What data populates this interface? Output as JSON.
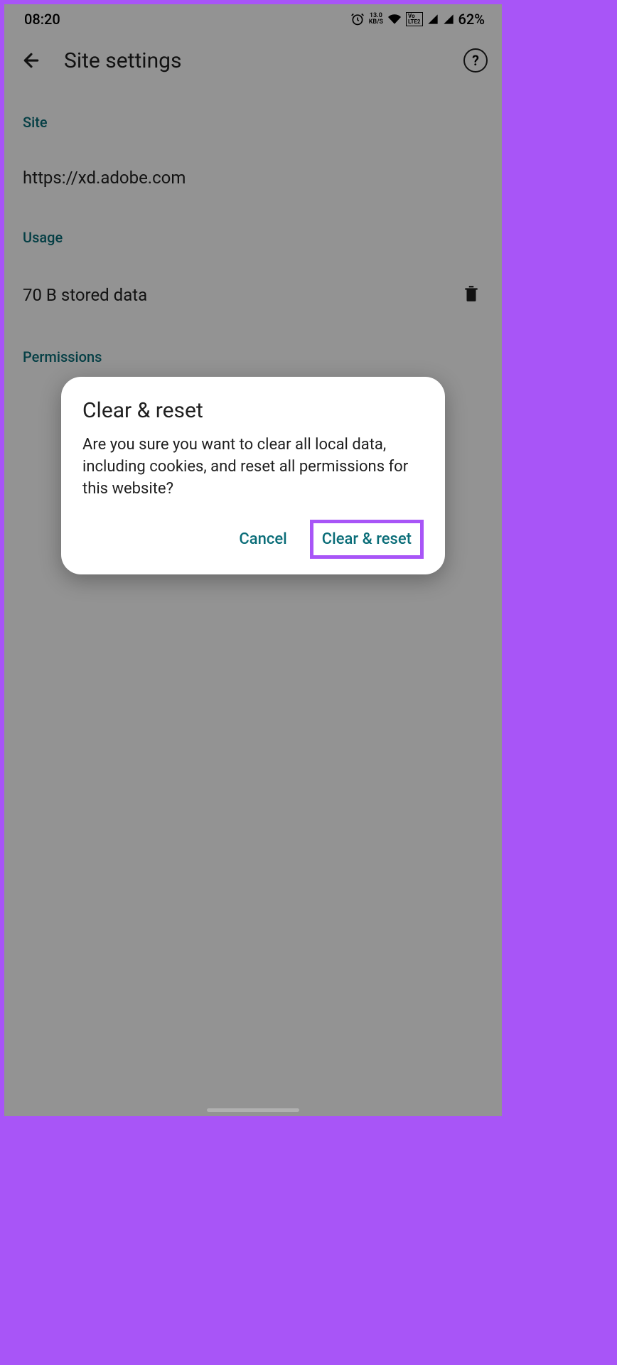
{
  "status": {
    "time": "08:20",
    "kbs_top": "13.0",
    "kbs_bot": "KB/S",
    "volte": "Vo LTE 2",
    "battery": "62%"
  },
  "appbar": {
    "title": "Site settings"
  },
  "sections": {
    "site_header": "Site",
    "site_url": "https://xd.adobe.com",
    "usage_header": "Usage",
    "usage_text": "70 B stored data",
    "permissions_header": "Permissions"
  },
  "dialog": {
    "title": "Clear & reset",
    "body": "Are you sure you want to clear all local data, including cookies, and reset all permissions for this website?",
    "cancel": "Cancel",
    "confirm": "Clear & reset"
  }
}
